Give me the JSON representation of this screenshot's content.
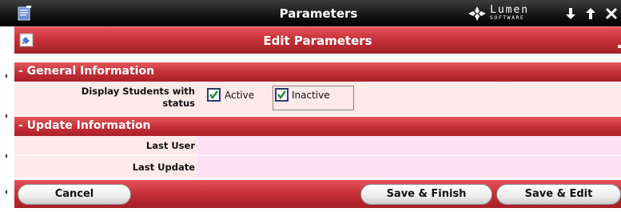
{
  "window": {
    "title": "Parameters"
  },
  "brand": {
    "name": "Lumen",
    "subtitle": "SOFTWARE"
  },
  "toolbar": {
    "buttons": [
      "arrow-down-icon",
      "arrow-up-icon",
      "close-icon"
    ]
  },
  "form": {
    "title": "Edit Parameters",
    "sections": [
      {
        "title": "- General Information",
        "fields": [
          {
            "label_line1": "Display Students with",
            "label_line2": "status",
            "options": [
              {
                "label": "Active",
                "checked": true
              },
              {
                "label": "Inactive",
                "checked": true
              }
            ]
          }
        ]
      },
      {
        "title": "- Update Information",
        "fields": [
          {
            "label": "Last User",
            "value": ""
          },
          {
            "label": "Last Update",
            "value": ""
          }
        ]
      }
    ]
  },
  "buttons": {
    "cancel": "Cancel",
    "save_finish": "Save & Finish",
    "save_edit": "Save & Edit"
  },
  "colors": {
    "header_red": "#c8323a",
    "row_pink": "#ffe9e9",
    "value_pink": "#fde0f3",
    "titlebar": "#1a1a1a"
  }
}
